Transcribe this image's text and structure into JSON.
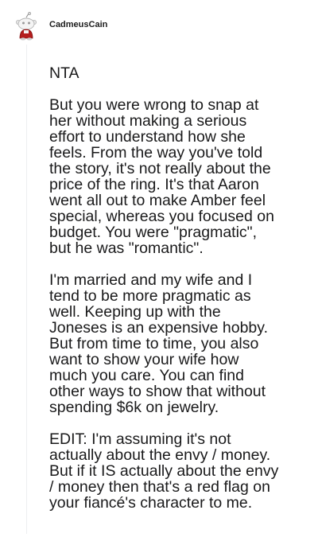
{
  "comment": {
    "username": "CadmeusCain",
    "avatar_icon": "snoo-avatar-icon",
    "paragraphs": [
      "NTA",
      "But you were wrong to snap at\nher without making a serious\neffort to understand how she\nfeels. From the way you've told\nthe story, it's not really about the\nprice of the ring. It's that Aaron\nwent all out to make Amber feel\nspecial, whereas you focused on\nbudget. You were \"pragmatic\",\nbut he was \"romantic\".",
      "I'm married and my wife and I\ntend to be more pragmatic as\nwell. Keeping up with the\nJoneses is an expensive hobby.\nBut from time to time, you also\nwant to show your wife how\nmuch you care. You can find\nother ways to show that without\nspending $6k on jewelry.",
      "EDIT: I'm assuming it's not\nactually about the envy / money.\nBut if it IS actually about the envy\n/ money then that's a red flag on\nyour fiancé's character to me."
    ]
  },
  "colors": {
    "text": "#1a1a1b",
    "thread_line": "#edeff1",
    "snoo_body": "#ffffff",
    "snoo_outline": "#b5b5b5",
    "snoo_shirt": "#b41e1e"
  }
}
